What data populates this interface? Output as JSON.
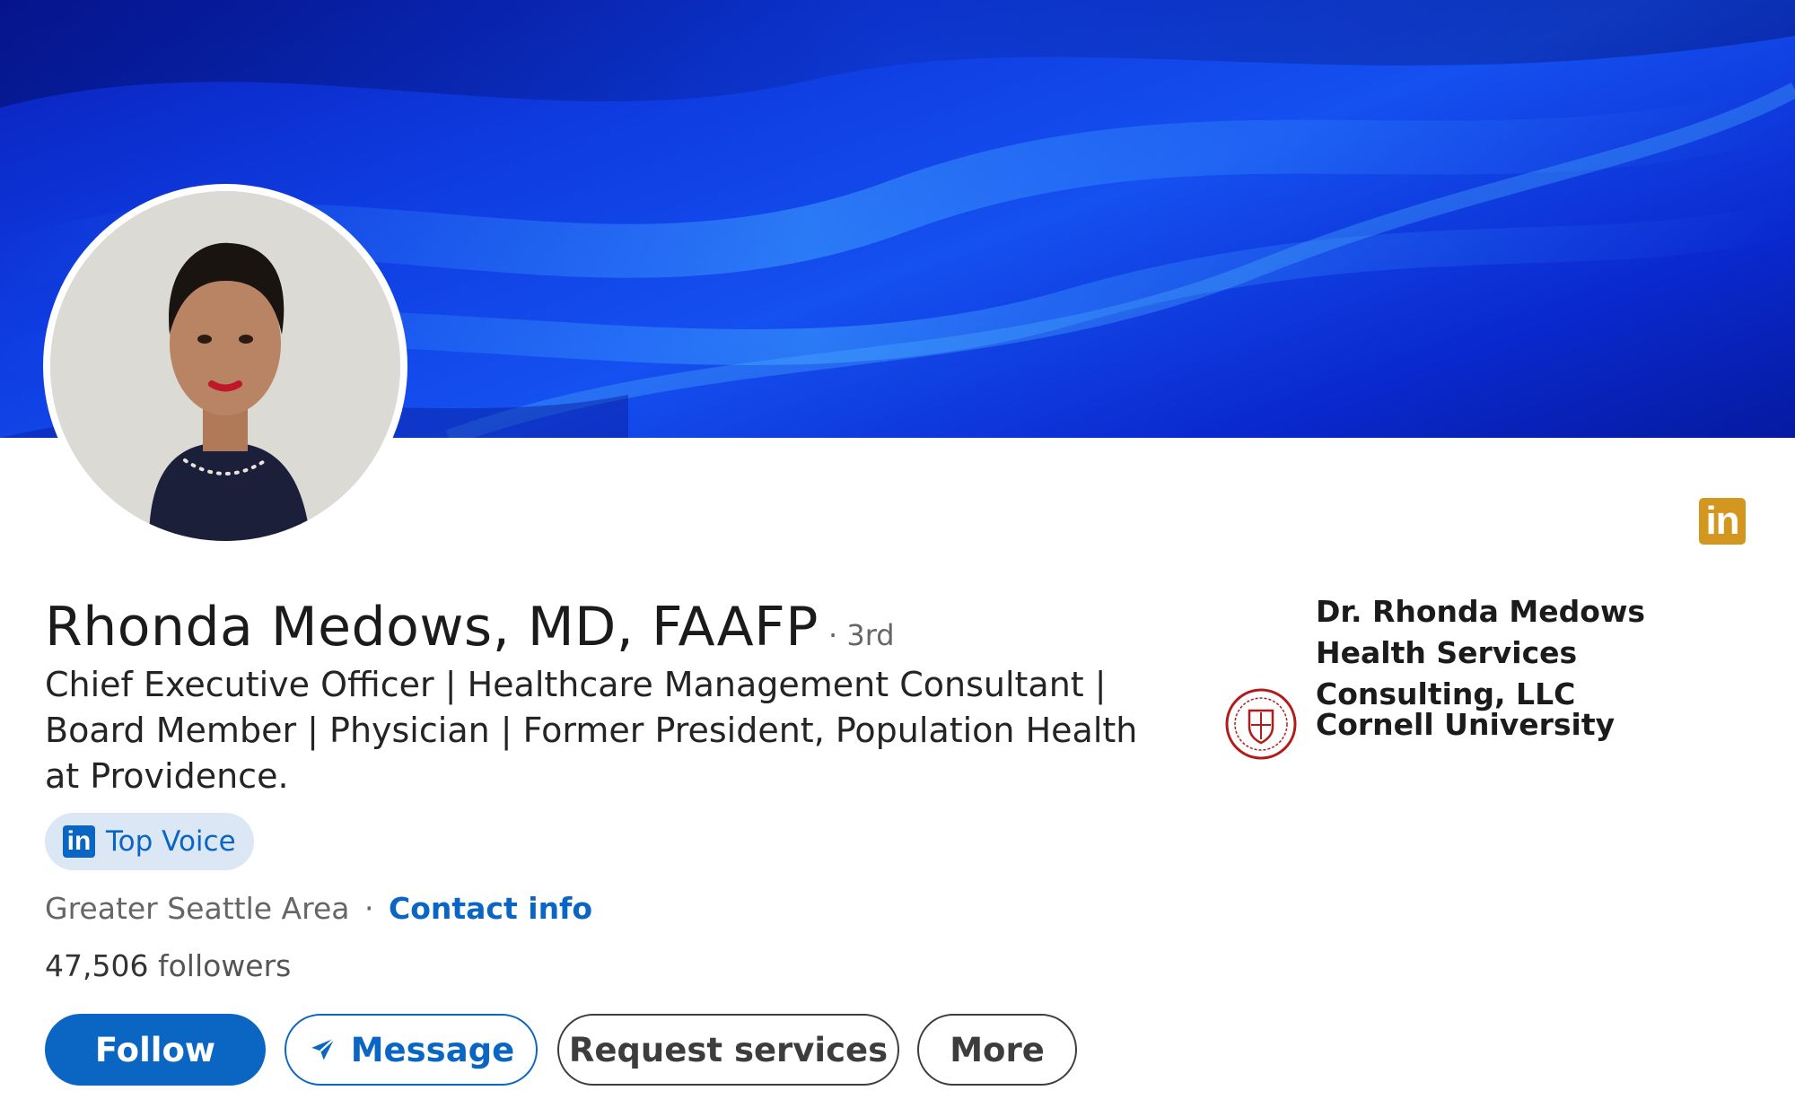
{
  "profile": {
    "name": "Rhonda Medows, MD, FAAFP",
    "degree": "· 3rd",
    "headline": "Chief Executive Officer | Healthcare Management Consultant | Board Member | Physician | Former President, Population Health at Providence.",
    "badge": {
      "icon": "linkedin-icon",
      "label": "Top Voice"
    },
    "location": "Greater Seattle Area",
    "separator": "·",
    "contact_link": "Contact info",
    "followers_count": "47,506",
    "followers_label": "followers"
  },
  "actions": {
    "follow": "Follow",
    "message": "Message",
    "request_services": "Request services",
    "more": "More"
  },
  "sidebar": {
    "company": "Dr. Rhonda Medows Health Services Consulting, LLC",
    "education": {
      "logo": "cornell-seal-icon",
      "name": "Cornell University"
    }
  },
  "icons": {
    "corner": "linkedin-icon",
    "corner_glyph": "in",
    "badge_glyph": "in",
    "message": "send-icon"
  },
  "colors": {
    "accent": "#0a66c2",
    "banner": "#0e3be0",
    "badge_bg": "#dbe7f5",
    "corner_icon": "#d3961f",
    "cornell_red": "#b31b1b"
  }
}
